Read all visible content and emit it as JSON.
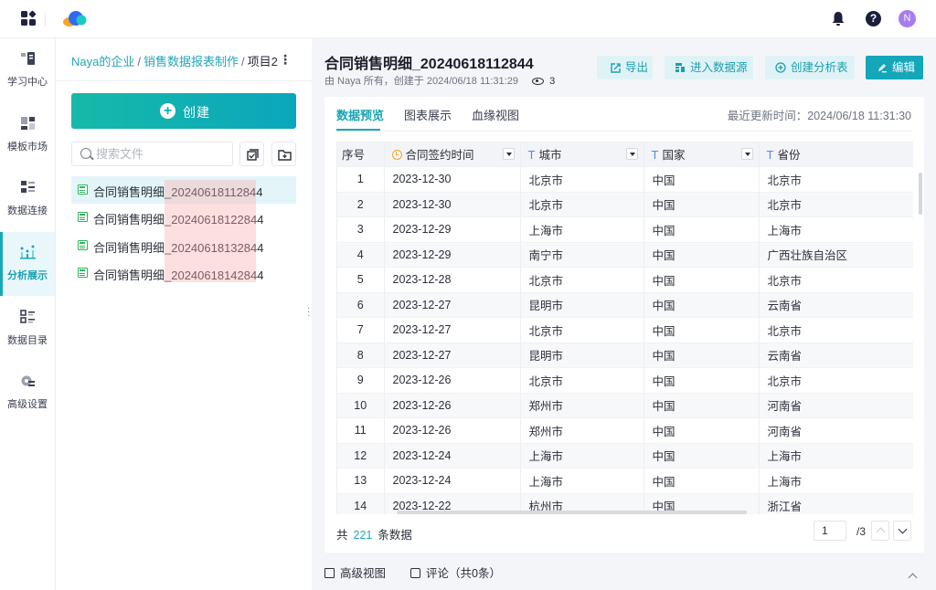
{
  "topbar": {
    "apps_icon": "grid-apps-icon",
    "logo": "cloud-logo",
    "notifications_icon": "bell-icon",
    "help_icon": "question-icon",
    "help_glyph": "?",
    "avatar_initial": "N",
    "avatar_color": "#a77cf0"
  },
  "leftnav": {
    "items": [
      {
        "label": "学习中心",
        "icon": "book-icon",
        "active": false
      },
      {
        "label": "模板市场",
        "icon": "template-icon",
        "active": false
      },
      {
        "label": "数据连接",
        "icon": "data-connection-icon",
        "active": false
      },
      {
        "label": "分析展示",
        "icon": "analysis-chart-icon",
        "active": true
      },
      {
        "label": "数据目录",
        "icon": "catalog-list-icon",
        "active": false
      },
      {
        "label": "高级设置",
        "icon": "settings-gear-icon",
        "active": false
      }
    ]
  },
  "filepanel": {
    "breadcrumb": [
      {
        "label": "Naya的企业",
        "link": true
      },
      {
        "label": "销售数据报表制作",
        "link": true
      },
      {
        "label": "项目2",
        "link": false
      }
    ],
    "separator": "/",
    "more_glyph": "⋮",
    "create_label": "创建",
    "create_glyph": "+",
    "search_placeholder": "搜索文件",
    "search_value": "",
    "batch_select_icon": "batch-select-icon",
    "new_folder_icon": "new-folder-icon",
    "files": [
      {
        "name": "合同销售明细_20240618112844",
        "selected": true
      },
      {
        "name": "合同销售明细_20240618122844",
        "selected": false
      },
      {
        "name": "合同销售明细_20240618132844",
        "selected": false
      },
      {
        "name": "合同销售明细_20240618142844",
        "selected": false
      }
    ]
  },
  "main": {
    "title": "合同销售明细_20240618112844",
    "meta": "由 Naya 所有，创建于 2024/06/18 11:31:29",
    "view_count": "3",
    "actions": {
      "export": "导出",
      "enter_datasource": "进入数据源",
      "create_analysis": "创建分析表",
      "edit": "编辑"
    },
    "tabs": [
      {
        "label": "数据预览",
        "active": true
      },
      {
        "label": "图表展示",
        "active": false
      },
      {
        "label": "血缘视图",
        "active": false
      }
    ],
    "last_updated": "最近更新时间：2024/06/18 11:31:30",
    "table": {
      "columns": [
        {
          "label": "序号",
          "type": "index"
        },
        {
          "label": "合同签约时间",
          "type": "time"
        },
        {
          "label": "城市",
          "type": "text",
          "type_glyph": "T"
        },
        {
          "label": "国家",
          "type": "text",
          "type_glyph": "T"
        },
        {
          "label": "省份",
          "type": "text",
          "type_glyph": "T"
        }
      ],
      "rows": [
        [
          "1",
          "2023-12-30",
          "北京市",
          "中国",
          "北京市"
        ],
        [
          "2",
          "2023-12-30",
          "北京市",
          "中国",
          "北京市"
        ],
        [
          "3",
          "2023-12-29",
          "上海市",
          "中国",
          "上海市"
        ],
        [
          "4",
          "2023-12-29",
          "南宁市",
          "中国",
          "广西壮族自治区"
        ],
        [
          "5",
          "2023-12-28",
          "北京市",
          "中国",
          "北京市"
        ],
        [
          "6",
          "2023-12-27",
          "昆明市",
          "中国",
          "云南省"
        ],
        [
          "7",
          "2023-12-27",
          "北京市",
          "中国",
          "北京市"
        ],
        [
          "8",
          "2023-12-27",
          "昆明市",
          "中国",
          "云南省"
        ],
        [
          "9",
          "2023-12-26",
          "北京市",
          "中国",
          "北京市"
        ],
        [
          "10",
          "2023-12-26",
          "郑州市",
          "中国",
          "河南省"
        ],
        [
          "11",
          "2023-12-26",
          "郑州市",
          "中国",
          "河南省"
        ],
        [
          "12",
          "2023-12-24",
          "上海市",
          "中国",
          "上海市"
        ],
        [
          "13",
          "2023-12-24",
          "上海市",
          "中国",
          "上海市"
        ],
        [
          "14",
          "2023-12-22",
          "杭州市",
          "中国",
          "浙江省"
        ]
      ]
    },
    "footer": {
      "prefix": "共",
      "total": "221",
      "suffix": "条数据",
      "page_value": "1",
      "page_total": "/3"
    },
    "bottombar": {
      "advanced_view": "高级视图",
      "comments": "评论（共0条）"
    }
  },
  "colors": {
    "accent": "#17a8b8",
    "primary_button": "#13a7b9",
    "link": "#22a6b5"
  }
}
